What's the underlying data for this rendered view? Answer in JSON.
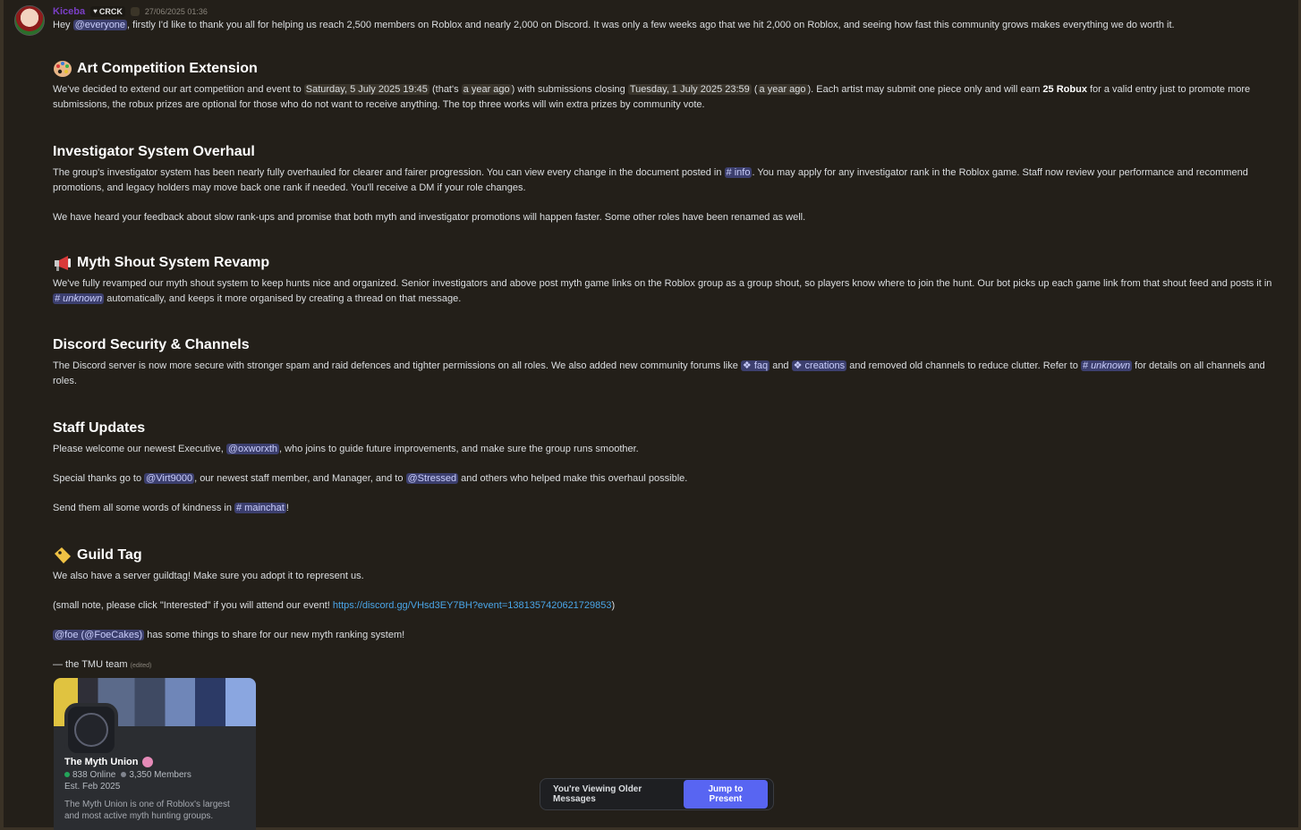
{
  "message": {
    "username": "Kiceba",
    "tag": "CRCK",
    "timestamp": "27/06/2025 01:36",
    "intro": {
      "hey": "Hey ",
      "mention": "@everyone",
      "text": ", firstly I'd like to thank you all for helping us reach 2,500 members on Roblox and nearly 2,000 on Discord. It was only a few weeks ago that we hit 2,000 on Roblox, and seeing how fast this community grows makes everything we do worth it."
    },
    "sections": {
      "art": {
        "title": "Art Competition Extension",
        "t1": "We've decided to extend our art competition and event to ",
        "date1": "Saturday, 5 July 2025 19:45",
        "t2": " (that's ",
        "ago1": "a year ago",
        "t3": ") with submissions closing ",
        "date2": "Tuesday, 1 July 2025 23:59",
        "t4": " (",
        "ago2": "a year ago",
        "t5": "). Each artist may submit one piece only and will earn ",
        "bold": "25 Robux",
        "t6": " for a valid entry just to promote more submissions, the robux prizes are optional for those who do not want to receive anything. The top three works will win extra prizes by community vote."
      },
      "investigator": {
        "title": "Investigator System Overhaul",
        "t1": "The group's investigator system has been nearly fully overhauled for clearer and fairer progression. You can view every change in the document posted in ",
        "channel": "# info",
        "t2": ". You may apply for any investigator rank in the Roblox game. Staff now review your performance and recommend promotions, and legacy holders may move back one rank if needed. You'll receive a DM if your role changes.",
        "p2": "We have heard your feedback about slow rank-ups and promise that both myth and investigator promotions will happen faster. Some other roles have been renamed as well."
      },
      "shout": {
        "title": "Myth Shout System Revamp",
        "t1": "We've fully revamped our myth shout system to keep hunts nice and organized. Senior investigators and above post myth game links on the Roblox group as a group shout, so players know where to join the hunt. Our bot picks up each game link from that shout feed and posts it in ",
        "channel": "# unknown",
        "t2": " automatically, and keeps it more organised by creating a thread on that message."
      },
      "security": {
        "title": "Discord Security & Channels",
        "t1": "The Discord server is now more secure with stronger spam and raid defences and tighter permissions on all roles. We also added new community forums like ",
        "forum1": "faq",
        "t2": " and ",
        "forum2": "creations",
        "t3": " and removed old channels to reduce clutter. Refer to ",
        "channel": "# unknown",
        "t4": " for details on all channels and roles."
      },
      "staff": {
        "title": "Staff Updates",
        "p1a": "Please welcome our newest Executive, ",
        "m1": "@oxworxth",
        "p1b": ", who joins to guide future improvements, and make sure the group runs smoother.",
        "p2a": "Special thanks go to ",
        "m2": "@Virt9000",
        "p2b": ", our newest staff member, and Manager, and to ",
        "m3": "@Stressed",
        "p2c": " and others who helped make this overhaul possible.",
        "p3a": "Send them all some words of kindness in ",
        "channel": "# mainchat",
        "p3b": "!"
      },
      "guild": {
        "title": "Guild Tag",
        "p1": "We also have a server guildtag! Make sure you adopt it to represent us.",
        "p2a": "(small note, please click \"Interested\" if you will attend our event! ",
        "link": "https://discord.gg/VHsd3EY7BH?event=1381357420621729853",
        "p2b": ")",
        "m1": "@foe (@FoeCakes)",
        "p3": " has some things to share for our new myth ranking system!",
        "sign": "— the TMU team",
        "edited": "(edited)"
      }
    },
    "invite": {
      "name": "The Myth Union",
      "online": "838 Online",
      "members": "3,350 Members",
      "est": "Est. Feb 2025",
      "desc": "The Myth Union is one of Roblox's largest and most active myth hunting groups."
    }
  },
  "older_bar": {
    "text": "You're Viewing Older Messages",
    "button": "Jump to Present"
  },
  "colors": {
    "background": "#231f19",
    "mention_bg": "#3c3f6e",
    "link": "#4aa6e8",
    "button": "#5865f2",
    "username": "#7a3fc6"
  },
  "icons": [
    "palette-icon",
    "megaphone-icon",
    "label-tag-icon",
    "forum-icon",
    "shield-heart-icon"
  ]
}
